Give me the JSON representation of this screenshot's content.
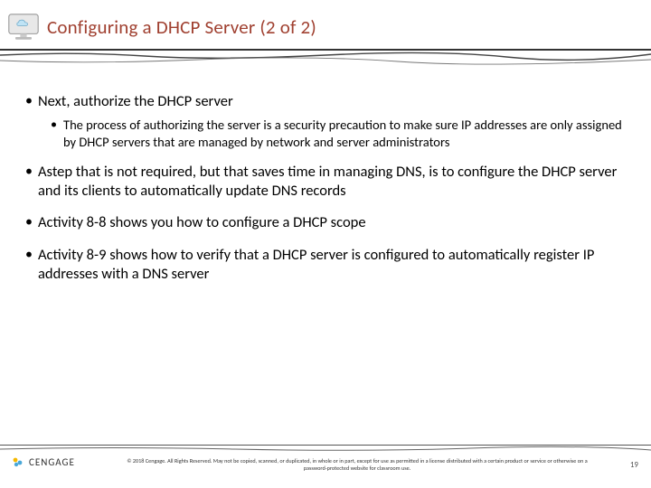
{
  "header": {
    "title": "Configuring a DHCP Server (2 of 2)",
    "icon_name": "cloud-monitor-icon"
  },
  "bullets": {
    "b1": "Next, authorize the DHCP server",
    "b1a": "The process of authorizing the server is a security precaution to make sure IP addresses are only assigned by DHCP servers that are managed by network and server administrators",
    "b2": "Astep that is not required, but that saves time in managing DNS, is to configure the DHCP server and its clients to automatically update DNS records",
    "b3": "Activity 8-8 shows you how to configure a DHCP scope",
    "b4": "Activity 8-9 shows how to verify that a DHCP server is configured to automatically register IP addresses with a DNS server"
  },
  "footer": {
    "brand": "CENGAGE",
    "copyright": "© 2018 Cengage. All Rights Reserved. May not be copied, scanned, or duplicated, in whole or in part, except for use as permitted in a license distributed with a certain product or service or otherwise on a password-protected website for classroom use.",
    "page": "19"
  }
}
